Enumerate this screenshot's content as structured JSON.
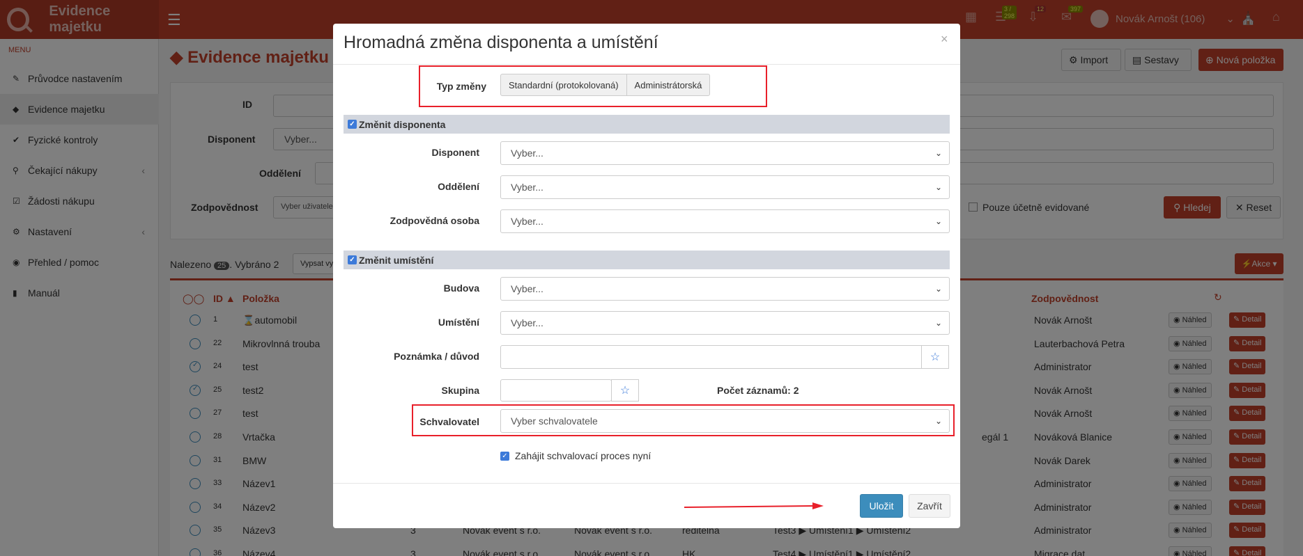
{
  "app": {
    "title": "Evidence majetku"
  },
  "topbar": {
    "badges": [
      "3 / 298",
      "12",
      "397"
    ],
    "user": "Novák Arnošt (106)"
  },
  "sidebar": {
    "menu_label": "MENU",
    "items": [
      {
        "label": "Průvodce nastavením",
        "icon": "pencil-icon"
      },
      {
        "label": "Evidence majetku",
        "icon": "gem-icon"
      },
      {
        "label": "Fyzické kontroly",
        "icon": "check-circle-icon"
      },
      {
        "label": "Čekající nákupy",
        "icon": "cart-icon"
      },
      {
        "label": "Žádosti nákupu",
        "icon": "checkbox-icon"
      },
      {
        "label": "Nastavení",
        "icon": "gears-icon"
      },
      {
        "label": "Přehled / pomoc",
        "icon": "globe-icon"
      },
      {
        "label": "Manuál",
        "icon": "book-icon"
      }
    ]
  },
  "page": {
    "title": "Evidence majetku",
    "import_label": "Import",
    "sestavy_label": "Sestavy",
    "nova_label": "Nová položka",
    "filters": {
      "id_label": "ID",
      "disponent_label": "Disponent",
      "disponent_value": "Vyber...",
      "oddeleni_label": "Oddělení",
      "zodpovednost_label": "Zodpovědnost",
      "zodpovednost_value": "Vyber uživatele",
      "pouze_label": "Pouze účetně evidované",
      "hledej_label": "Hledej",
      "reset_label": "Reset"
    },
    "found_prefix": "Nalezeno",
    "found_count": "25",
    "selected_text": ". Vybráno 2",
    "vypsat_label": "Vypsat vy",
    "akce_label": "Akce",
    "table": {
      "headers": {
        "id": "ID",
        "polozka": "Položka",
        "zodpovednost": "Zodpovědnost"
      },
      "nahled_label": "Náhled",
      "detail_label": "Detail",
      "rows": [
        {
          "id": "1",
          "name": "automobil",
          "resp": "Novák Arnošt"
        },
        {
          "id": "22",
          "name": "Mikrovlnná trouba",
          "resp": "Lauterbachová Petra"
        },
        {
          "id": "24",
          "name": "test",
          "resp": "Administrator"
        },
        {
          "id": "25",
          "name": "test2",
          "resp": "Novák Arnošt"
        },
        {
          "id": "27",
          "name": "test",
          "resp": "Novák Arnošt"
        },
        {
          "id": "28",
          "name": "Vrtačka",
          "resp": "Nováková Blanice"
        },
        {
          "id": "31",
          "name": "BMW",
          "resp": "Novák Darek"
        },
        {
          "id": "33",
          "name": "Název1",
          "resp": "Administrator"
        },
        {
          "id": "34",
          "name": "Název2",
          "resp": "Administrator"
        },
        {
          "id": "35",
          "name": "Název3",
          "resp": "Administrator"
        },
        {
          "id": "36",
          "name": "Název4",
          "resp": "Migrace dat"
        }
      ],
      "row35_extra": [
        "3",
        "Novák event s r.o.",
        "Novák event s r.o.",
        "ředitelna",
        "Test3 ▶ Umístění1 ▶ Umístění2"
      ],
      "row36_extra": [
        "3",
        "Novák event s r.o.",
        "Novák event s r.o.",
        "HK",
        "Test4 ▶ Umístění1 ▶ Umístění2"
      ],
      "row28_extra": "egál 1"
    }
  },
  "modal": {
    "title": "Hromadná změna disponenta a umístění",
    "close": "×",
    "typ_label": "Typ změny",
    "typ_options": [
      "Standardní (protokolovaná)",
      "Administrátorská"
    ],
    "section1": "Změnit disponenta",
    "disponent_label": "Disponent",
    "oddeleni_label": "Oddělení",
    "zodpovedna_label": "Zodpovědná osoba",
    "placeholder": "Vyber...",
    "section2": "Změnit umístění",
    "budova_label": "Budova",
    "umisteni_label": "Umístění",
    "poznamka_label": "Poznámka / důvod",
    "skupina_label": "Skupina",
    "pocet_label": "Počet záznamů: 2",
    "schvalovatel_label": "Schvalovatel",
    "schvalovatel_value": "Vyber schvalovatele",
    "zahajit_label": "Zahájit schvalovací proces nyní",
    "ulozit_label": "Uložit",
    "zavrit_label": "Zavřít"
  }
}
